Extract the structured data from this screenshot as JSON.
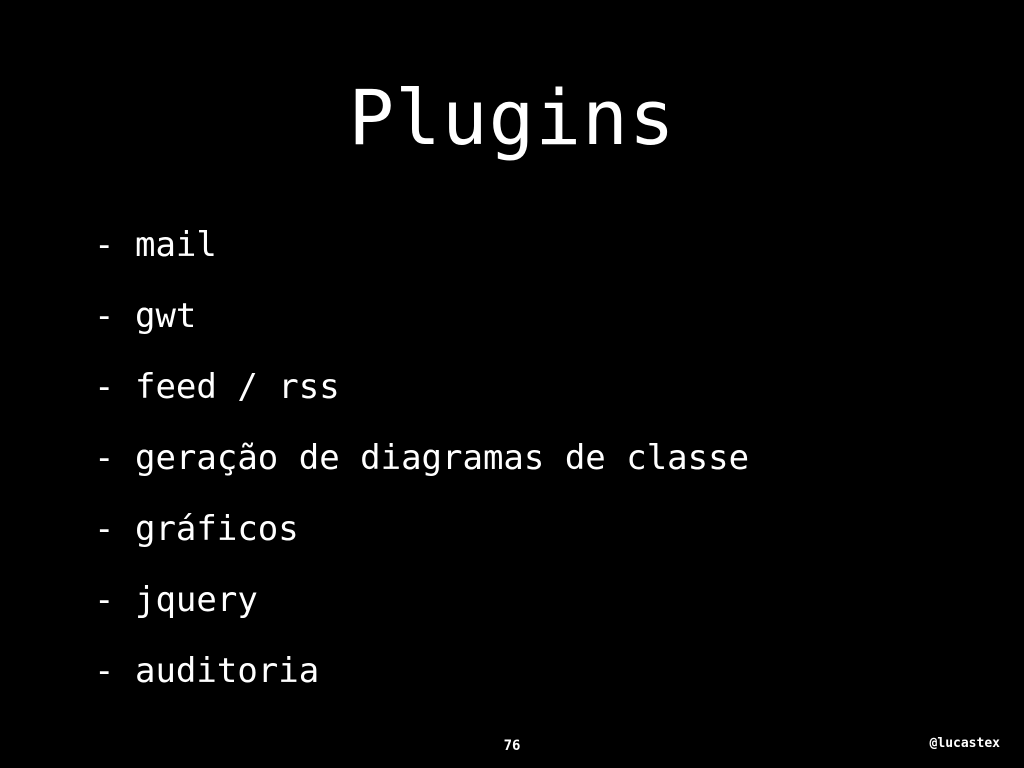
{
  "slide": {
    "title": "Plugins",
    "items": [
      {
        "bullet": "-",
        "text": "mail"
      },
      {
        "bullet": "-",
        "text": "gwt"
      },
      {
        "bullet": "-",
        "text": "feed / rss"
      },
      {
        "bullet": "-",
        "text": "geração de diagramas de classe"
      },
      {
        "bullet": "-",
        "text": "gráficos"
      },
      {
        "bullet": "-",
        "text": "jquery"
      },
      {
        "bullet": "-",
        "text": "auditoria"
      }
    ],
    "page_number": "76",
    "author_handle": "@lucastex"
  },
  "colors": {
    "background": "#000000",
    "text": "#ffffff"
  }
}
